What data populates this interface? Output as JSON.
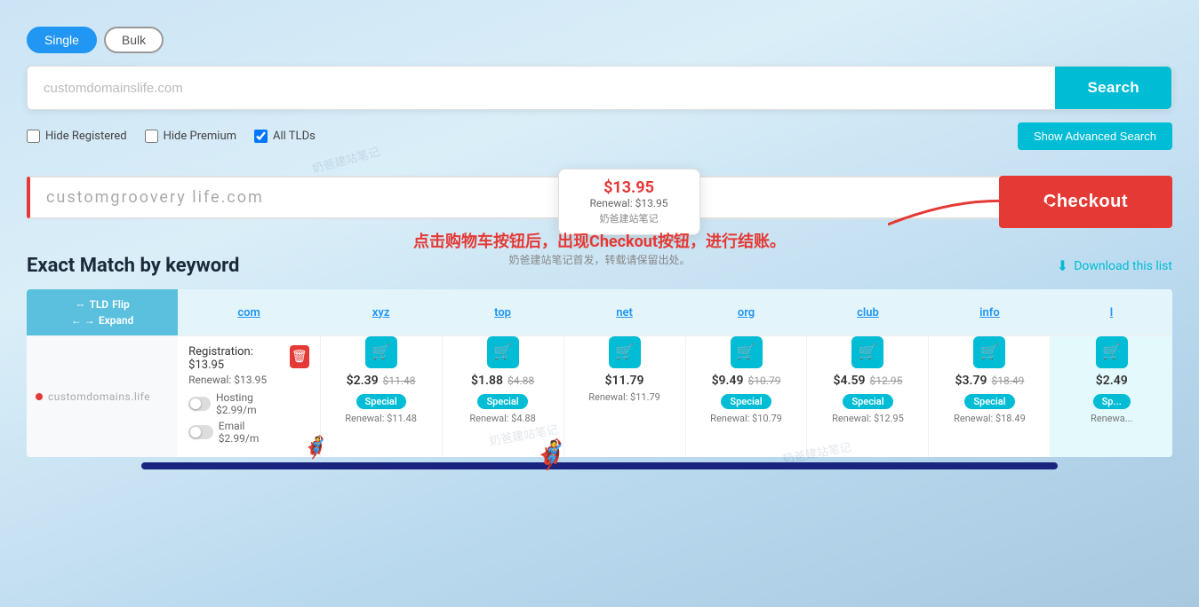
{
  "page": {
    "background": "#cce8f5"
  },
  "toggle": {
    "single_label": "Single",
    "bulk_label": "Bulk"
  },
  "search": {
    "placeholder": "customdomainslife.com",
    "button_label": "Search"
  },
  "filters": {
    "hide_registered": "Hide Registered",
    "hide_premium": "Hide Premium",
    "all_tlds": "All TLDs",
    "advanced_btn": "Show Advanced Search"
  },
  "result": {
    "domain_name": "customgroovery life.com",
    "price": "$13.95",
    "renewal": "Renewal: $13.95",
    "watermark": "奶爸建站笔记"
  },
  "checkout": {
    "button_label": "Checkout"
  },
  "annotation": {
    "main": "点击购物车按钮后，出现Checkout按钮，进行结账。",
    "sub": "奶爸建站笔记首发，转载请保留出处。"
  },
  "section": {
    "title": "Exact Match by keyword",
    "download_label": "Download this list"
  },
  "table": {
    "flip_label": "TLD",
    "flip_sublabel": "Flip",
    "expand_label": "Expand",
    "columns": [
      "com",
      "xyz",
      "top",
      "net",
      "org",
      "club",
      "info",
      "l"
    ],
    "domain_row": {
      "name": "customdomains.life",
      "com_registration": "Registration: $13.95",
      "com_renewal": "Renewal: $13.95",
      "hosting": "Hosting $2.99/m",
      "email": "Email $2.99/m",
      "tlds": [
        {
          "tld": "xyz",
          "price": "$2.39",
          "old_price": "$11.48",
          "special": true,
          "renewal": "Renewal: $11.48"
        },
        {
          "tld": "top",
          "price": "$1.88",
          "old_price": "$4.88",
          "special": true,
          "renewal": "Renewal: $4.88"
        },
        {
          "tld": "net",
          "price": "$11.79",
          "old_price": null,
          "special": false,
          "renewal": "Renewal: $11.79"
        },
        {
          "tld": "org",
          "price": "$9.49",
          "old_price": "$10.79",
          "special": true,
          "renewal": "Renewal: $10.79"
        },
        {
          "tld": "club",
          "price": "$4.59",
          "old_price": "$12.95",
          "special": true,
          "renewal": "Renewal: $12.95"
        },
        {
          "tld": "info",
          "price": "$3.79",
          "old_price": "$18.49",
          "special": true,
          "renewal": "Renewal: $18.49"
        },
        {
          "tld": "l",
          "price": "$2.49",
          "old_price": null,
          "special": true,
          "renewal": "Renewa..."
        }
      ]
    }
  }
}
